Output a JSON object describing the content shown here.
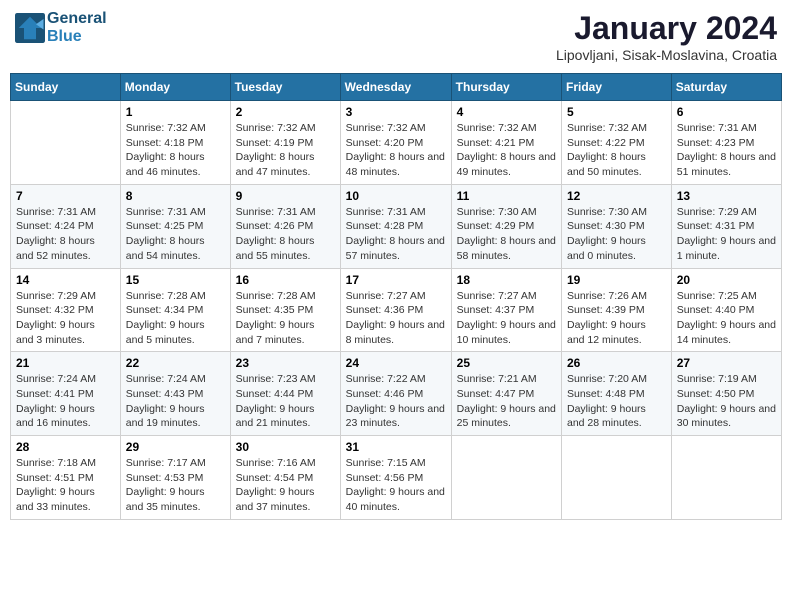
{
  "header": {
    "logo_line1": "General",
    "logo_line2": "Blue",
    "title": "January 2024",
    "subtitle": "Lipovljani, Sisak-Moslavina, Croatia"
  },
  "days_of_week": [
    "Sunday",
    "Monday",
    "Tuesday",
    "Wednesday",
    "Thursday",
    "Friday",
    "Saturday"
  ],
  "weeks": [
    [
      {
        "day": "",
        "sunrise": "",
        "sunset": "",
        "daylight": ""
      },
      {
        "day": "1",
        "sunrise": "Sunrise: 7:32 AM",
        "sunset": "Sunset: 4:18 PM",
        "daylight": "Daylight: 8 hours and 46 minutes."
      },
      {
        "day": "2",
        "sunrise": "Sunrise: 7:32 AM",
        "sunset": "Sunset: 4:19 PM",
        "daylight": "Daylight: 8 hours and 47 minutes."
      },
      {
        "day": "3",
        "sunrise": "Sunrise: 7:32 AM",
        "sunset": "Sunset: 4:20 PM",
        "daylight": "Daylight: 8 hours and 48 minutes."
      },
      {
        "day": "4",
        "sunrise": "Sunrise: 7:32 AM",
        "sunset": "Sunset: 4:21 PM",
        "daylight": "Daylight: 8 hours and 49 minutes."
      },
      {
        "day": "5",
        "sunrise": "Sunrise: 7:32 AM",
        "sunset": "Sunset: 4:22 PM",
        "daylight": "Daylight: 8 hours and 50 minutes."
      },
      {
        "day": "6",
        "sunrise": "Sunrise: 7:31 AM",
        "sunset": "Sunset: 4:23 PM",
        "daylight": "Daylight: 8 hours and 51 minutes."
      }
    ],
    [
      {
        "day": "7",
        "sunrise": "Sunrise: 7:31 AM",
        "sunset": "Sunset: 4:24 PM",
        "daylight": "Daylight: 8 hours and 52 minutes."
      },
      {
        "day": "8",
        "sunrise": "Sunrise: 7:31 AM",
        "sunset": "Sunset: 4:25 PM",
        "daylight": "Daylight: 8 hours and 54 minutes."
      },
      {
        "day": "9",
        "sunrise": "Sunrise: 7:31 AM",
        "sunset": "Sunset: 4:26 PM",
        "daylight": "Daylight: 8 hours and 55 minutes."
      },
      {
        "day": "10",
        "sunrise": "Sunrise: 7:31 AM",
        "sunset": "Sunset: 4:28 PM",
        "daylight": "Daylight: 8 hours and 57 minutes."
      },
      {
        "day": "11",
        "sunrise": "Sunrise: 7:30 AM",
        "sunset": "Sunset: 4:29 PM",
        "daylight": "Daylight: 8 hours and 58 minutes."
      },
      {
        "day": "12",
        "sunrise": "Sunrise: 7:30 AM",
        "sunset": "Sunset: 4:30 PM",
        "daylight": "Daylight: 9 hours and 0 minutes."
      },
      {
        "day": "13",
        "sunrise": "Sunrise: 7:29 AM",
        "sunset": "Sunset: 4:31 PM",
        "daylight": "Daylight: 9 hours and 1 minute."
      }
    ],
    [
      {
        "day": "14",
        "sunrise": "Sunrise: 7:29 AM",
        "sunset": "Sunset: 4:32 PM",
        "daylight": "Daylight: 9 hours and 3 minutes."
      },
      {
        "day": "15",
        "sunrise": "Sunrise: 7:28 AM",
        "sunset": "Sunset: 4:34 PM",
        "daylight": "Daylight: 9 hours and 5 minutes."
      },
      {
        "day": "16",
        "sunrise": "Sunrise: 7:28 AM",
        "sunset": "Sunset: 4:35 PM",
        "daylight": "Daylight: 9 hours and 7 minutes."
      },
      {
        "day": "17",
        "sunrise": "Sunrise: 7:27 AM",
        "sunset": "Sunset: 4:36 PM",
        "daylight": "Daylight: 9 hours and 8 minutes."
      },
      {
        "day": "18",
        "sunrise": "Sunrise: 7:27 AM",
        "sunset": "Sunset: 4:37 PM",
        "daylight": "Daylight: 9 hours and 10 minutes."
      },
      {
        "day": "19",
        "sunrise": "Sunrise: 7:26 AM",
        "sunset": "Sunset: 4:39 PM",
        "daylight": "Daylight: 9 hours and 12 minutes."
      },
      {
        "day": "20",
        "sunrise": "Sunrise: 7:25 AM",
        "sunset": "Sunset: 4:40 PM",
        "daylight": "Daylight: 9 hours and 14 minutes."
      }
    ],
    [
      {
        "day": "21",
        "sunrise": "Sunrise: 7:24 AM",
        "sunset": "Sunset: 4:41 PM",
        "daylight": "Daylight: 9 hours and 16 minutes."
      },
      {
        "day": "22",
        "sunrise": "Sunrise: 7:24 AM",
        "sunset": "Sunset: 4:43 PM",
        "daylight": "Daylight: 9 hours and 19 minutes."
      },
      {
        "day": "23",
        "sunrise": "Sunrise: 7:23 AM",
        "sunset": "Sunset: 4:44 PM",
        "daylight": "Daylight: 9 hours and 21 minutes."
      },
      {
        "day": "24",
        "sunrise": "Sunrise: 7:22 AM",
        "sunset": "Sunset: 4:46 PM",
        "daylight": "Daylight: 9 hours and 23 minutes."
      },
      {
        "day": "25",
        "sunrise": "Sunrise: 7:21 AM",
        "sunset": "Sunset: 4:47 PM",
        "daylight": "Daylight: 9 hours and 25 minutes."
      },
      {
        "day": "26",
        "sunrise": "Sunrise: 7:20 AM",
        "sunset": "Sunset: 4:48 PM",
        "daylight": "Daylight: 9 hours and 28 minutes."
      },
      {
        "day": "27",
        "sunrise": "Sunrise: 7:19 AM",
        "sunset": "Sunset: 4:50 PM",
        "daylight": "Daylight: 9 hours and 30 minutes."
      }
    ],
    [
      {
        "day": "28",
        "sunrise": "Sunrise: 7:18 AM",
        "sunset": "Sunset: 4:51 PM",
        "daylight": "Daylight: 9 hours and 33 minutes."
      },
      {
        "day": "29",
        "sunrise": "Sunrise: 7:17 AM",
        "sunset": "Sunset: 4:53 PM",
        "daylight": "Daylight: 9 hours and 35 minutes."
      },
      {
        "day": "30",
        "sunrise": "Sunrise: 7:16 AM",
        "sunset": "Sunset: 4:54 PM",
        "daylight": "Daylight: 9 hours and 37 minutes."
      },
      {
        "day": "31",
        "sunrise": "Sunrise: 7:15 AM",
        "sunset": "Sunset: 4:56 PM",
        "daylight": "Daylight: 9 hours and 40 minutes."
      },
      {
        "day": "",
        "sunrise": "",
        "sunset": "",
        "daylight": ""
      },
      {
        "day": "",
        "sunrise": "",
        "sunset": "",
        "daylight": ""
      },
      {
        "day": "",
        "sunrise": "",
        "sunset": "",
        "daylight": ""
      }
    ]
  ]
}
